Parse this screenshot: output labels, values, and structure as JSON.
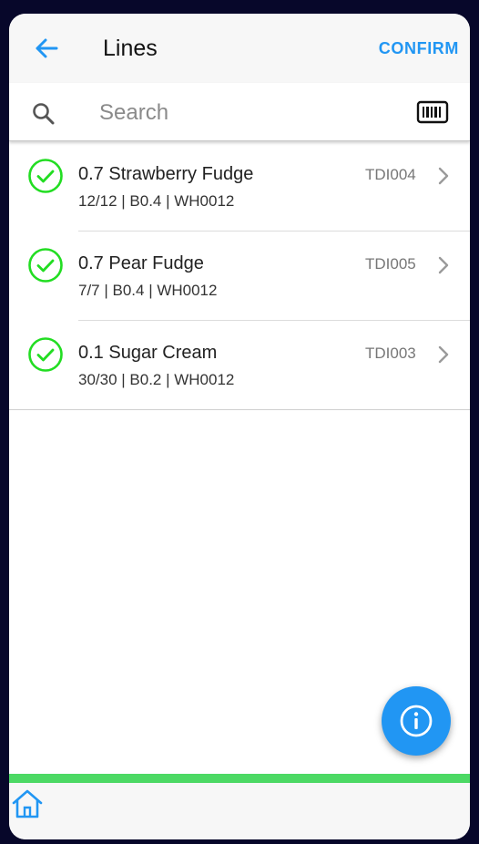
{
  "header": {
    "title": "Lines",
    "confirm_label": "CONFIRM"
  },
  "search": {
    "placeholder": "Search",
    "value": ""
  },
  "lines": [
    {
      "name": "0.7 Strawberry Fudge",
      "code": "TDI004",
      "details": "12/12 | B0.4 | WH0012"
    },
    {
      "name": "0.7 Pear Fudge",
      "code": "TDI005",
      "details": "7/7 | B0.4 | WH0012"
    },
    {
      "name": "0.1 Sugar Cream",
      "code": "TDI003",
      "details": "30/30 | B0.2 | WH0012"
    }
  ],
  "icons": {
    "back": "arrow-left-icon",
    "search": "search-icon",
    "barcode": "barcode-icon",
    "status": "check-circle-icon",
    "chevron": "chevron-right-icon",
    "info": "info-icon",
    "home": "home-icon"
  },
  "colors": {
    "accent": "#2196f3",
    "check": "#22dd22",
    "status_bar": "#4cd964",
    "frame": "#07072a"
  }
}
